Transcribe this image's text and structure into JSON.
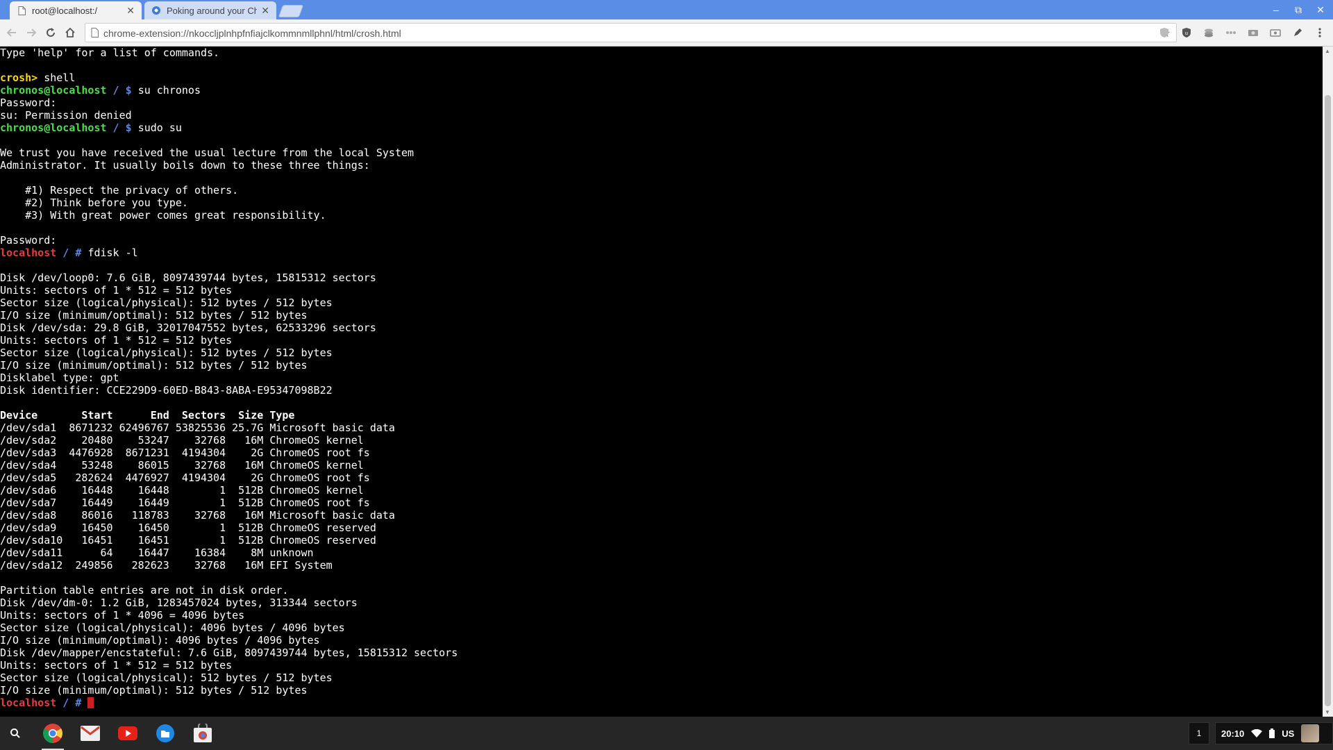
{
  "browser": {
    "tabs": [
      {
        "title": "root@localhost:/",
        "active": true
      },
      {
        "title": "Poking around your Chr",
        "active": false
      }
    ],
    "url": "chrome-extension://nkoccljplnhpfnfiajclkommnmllphnl/html/crosh.html",
    "window_controls": {
      "minimize": "–",
      "restore": "⧉",
      "close": "✕"
    }
  },
  "terminal": {
    "lines": [
      [
        {
          "text": "Type 'help' for a list of commands."
        }
      ],
      [
        {
          "text": ""
        }
      ],
      [
        {
          "text": "crosh> ",
          "cls": "p-yellow"
        },
        {
          "text": "shell"
        }
      ],
      [
        {
          "text": "chronos@localhost",
          "cls": "p-green"
        },
        {
          "text": " / $ ",
          "cls": "p-blue"
        },
        {
          "text": "su chronos"
        }
      ],
      [
        {
          "text": "Password:"
        }
      ],
      [
        {
          "text": "su: Permission denied"
        }
      ],
      [
        {
          "text": "chronos@localhost",
          "cls": "p-green"
        },
        {
          "text": " / $ ",
          "cls": "p-blue"
        },
        {
          "text": "sudo su"
        }
      ],
      [
        {
          "text": ""
        }
      ],
      [
        {
          "text": "We trust you have received the usual lecture from the local System"
        }
      ],
      [
        {
          "text": "Administrator. It usually boils down to these three things:"
        }
      ],
      [
        {
          "text": ""
        }
      ],
      [
        {
          "text": "    #1) Respect the privacy of others."
        }
      ],
      [
        {
          "text": "    #2) Think before you type."
        }
      ],
      [
        {
          "text": "    #3) With great power comes great responsibility."
        }
      ],
      [
        {
          "text": ""
        }
      ],
      [
        {
          "text": "Password:"
        }
      ],
      [
        {
          "text": "localhost",
          "cls": "p-red"
        },
        {
          "text": " / # ",
          "cls": "p-blue"
        },
        {
          "text": "fdisk -l"
        }
      ],
      [
        {
          "text": ""
        }
      ],
      [
        {
          "text": "Disk /dev/loop0: 7.6 GiB, 8097439744 bytes, 15815312 sectors"
        }
      ],
      [
        {
          "text": "Units: sectors of 1 * 512 = 512 bytes"
        }
      ],
      [
        {
          "text": "Sector size (logical/physical): 512 bytes / 512 bytes"
        }
      ],
      [
        {
          "text": "I/O size (minimum/optimal): 512 bytes / 512 bytes"
        }
      ],
      [
        {
          "text": "Disk /dev/sda: 29.8 GiB, 32017047552 bytes, 62533296 sectors"
        }
      ],
      [
        {
          "text": "Units: sectors of 1 * 512 = 512 bytes"
        }
      ],
      [
        {
          "text": "Sector size (logical/physical): 512 bytes / 512 bytes"
        }
      ],
      [
        {
          "text": "I/O size (minimum/optimal): 512 bytes / 512 bytes"
        }
      ],
      [
        {
          "text": "Disklabel type: gpt"
        }
      ],
      [
        {
          "text": "Disk identifier: CCE229D9-60ED-B843-8ABA-E95347098B22"
        }
      ],
      [
        {
          "text": ""
        }
      ],
      [
        {
          "text": "Device       Start      End  Sectors  Size Type",
          "cls": "bold"
        }
      ],
      [
        {
          "text": "/dev/sda1  8671232 62496767 53825536 25.7G Microsoft basic data"
        }
      ],
      [
        {
          "text": "/dev/sda2    20480    53247    32768   16M ChromeOS kernel"
        }
      ],
      [
        {
          "text": "/dev/sda3  4476928  8671231  4194304    2G ChromeOS root fs"
        }
      ],
      [
        {
          "text": "/dev/sda4    53248    86015    32768   16M ChromeOS kernel"
        }
      ],
      [
        {
          "text": "/dev/sda5   282624  4476927  4194304    2G ChromeOS root fs"
        }
      ],
      [
        {
          "text": "/dev/sda6    16448    16448        1  512B ChromeOS kernel"
        }
      ],
      [
        {
          "text": "/dev/sda7    16449    16449        1  512B ChromeOS root fs"
        }
      ],
      [
        {
          "text": "/dev/sda8    86016   118783    32768   16M Microsoft basic data"
        }
      ],
      [
        {
          "text": "/dev/sda9    16450    16450        1  512B ChromeOS reserved"
        }
      ],
      [
        {
          "text": "/dev/sda10   16451    16451        1  512B ChromeOS reserved"
        }
      ],
      [
        {
          "text": "/dev/sda11      64    16447    16384    8M unknown"
        }
      ],
      [
        {
          "text": "/dev/sda12  249856   282623    32768   16M EFI System"
        }
      ],
      [
        {
          "text": ""
        }
      ],
      [
        {
          "text": "Partition table entries are not in disk order."
        }
      ],
      [
        {
          "text": "Disk /dev/dm-0: 1.2 GiB, 1283457024 bytes, 313344 sectors"
        }
      ],
      [
        {
          "text": "Units: sectors of 1 * 4096 = 4096 bytes"
        }
      ],
      [
        {
          "text": "Sector size (logical/physical): 4096 bytes / 4096 bytes"
        }
      ],
      [
        {
          "text": "I/O size (minimum/optimal): 4096 bytes / 4096 bytes"
        }
      ],
      [
        {
          "text": "Disk /dev/mapper/encstateful: 7.6 GiB, 8097439744 bytes, 15815312 sectors"
        }
      ],
      [
        {
          "text": "Units: sectors of 1 * 512 = 512 bytes"
        }
      ],
      [
        {
          "text": "Sector size (logical/physical): 512 bytes / 512 bytes"
        }
      ],
      [
        {
          "text": "I/O size (minimum/optimal): 512 bytes / 512 bytes"
        }
      ],
      [
        {
          "text": "localhost",
          "cls": "p-red"
        },
        {
          "text": " / # ",
          "cls": "p-blue"
        },
        {
          "cursor": true
        }
      ]
    ]
  },
  "shelf": {
    "apps": [
      "chrome-icon",
      "gmail-icon",
      "youtube-icon",
      "files-icon",
      "web-store-icon"
    ],
    "notification_count": "1",
    "time": "20:10",
    "keyboard_layout": "US"
  },
  "colors": {
    "tabstrip": "#5a8ee6",
    "prompt_user": "#4ae04a",
    "prompt_path": "#5b87e6",
    "prompt_root": "#e83b3b",
    "prompt_crosh": "#ffd500"
  }
}
